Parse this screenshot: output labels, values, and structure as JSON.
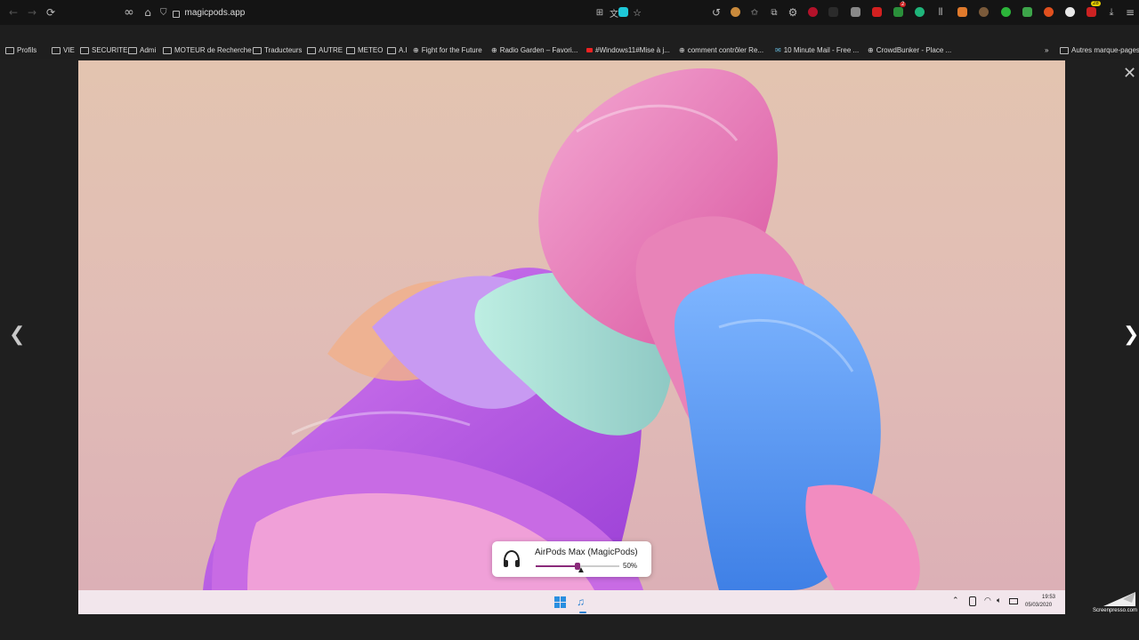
{
  "browser": {
    "url": "magicpods.app",
    "toolbar_icons": [
      "back-icon",
      "forward-icon",
      "reload-icon",
      "infinity-icon",
      "home-icon",
      "shield-icon",
      "lock-icon"
    ],
    "extension_badges": {
      "badge_a": "2",
      "badge_b": "28"
    }
  },
  "bookmarks": {
    "items": [
      {
        "label": "Profils",
        "icon": "folder"
      },
      {
        "label": "VIE",
        "icon": "folder"
      },
      {
        "label": "SECURITE",
        "icon": "folder"
      },
      {
        "label": "Admi",
        "icon": "folder"
      },
      {
        "label": "MOTEUR de Recherche",
        "icon": "folder"
      },
      {
        "label": "Traducteurs",
        "icon": "folder"
      },
      {
        "label": "AUTRE",
        "icon": "folder"
      },
      {
        "label": "METEO",
        "icon": "folder"
      },
      {
        "label": "A.I",
        "icon": "folder"
      },
      {
        "label": "Fight for the Future",
        "icon": "globe"
      },
      {
        "label": "Radio Garden – Favori...",
        "icon": "globe"
      },
      {
        "label": "#Windows11#Mise à j...",
        "icon": "youtube"
      },
      {
        "label": "comment contrôler Re...",
        "icon": "globe"
      },
      {
        "label": "10 Minute Mail - Free ...",
        "icon": "mail"
      },
      {
        "label": "CrowdBunker - Place ...",
        "icon": "globe"
      }
    ],
    "overflow_label": "Autres marque-pages"
  },
  "popup": {
    "device_name": "AirPods Max (MagicPods)",
    "volume_text": "50%",
    "volume_fraction": 0.5
  },
  "tray": {
    "time": "19:53",
    "date": "05/03/2020"
  },
  "watermark": {
    "text": "Screenpresso",
    "subtext": ".com"
  }
}
